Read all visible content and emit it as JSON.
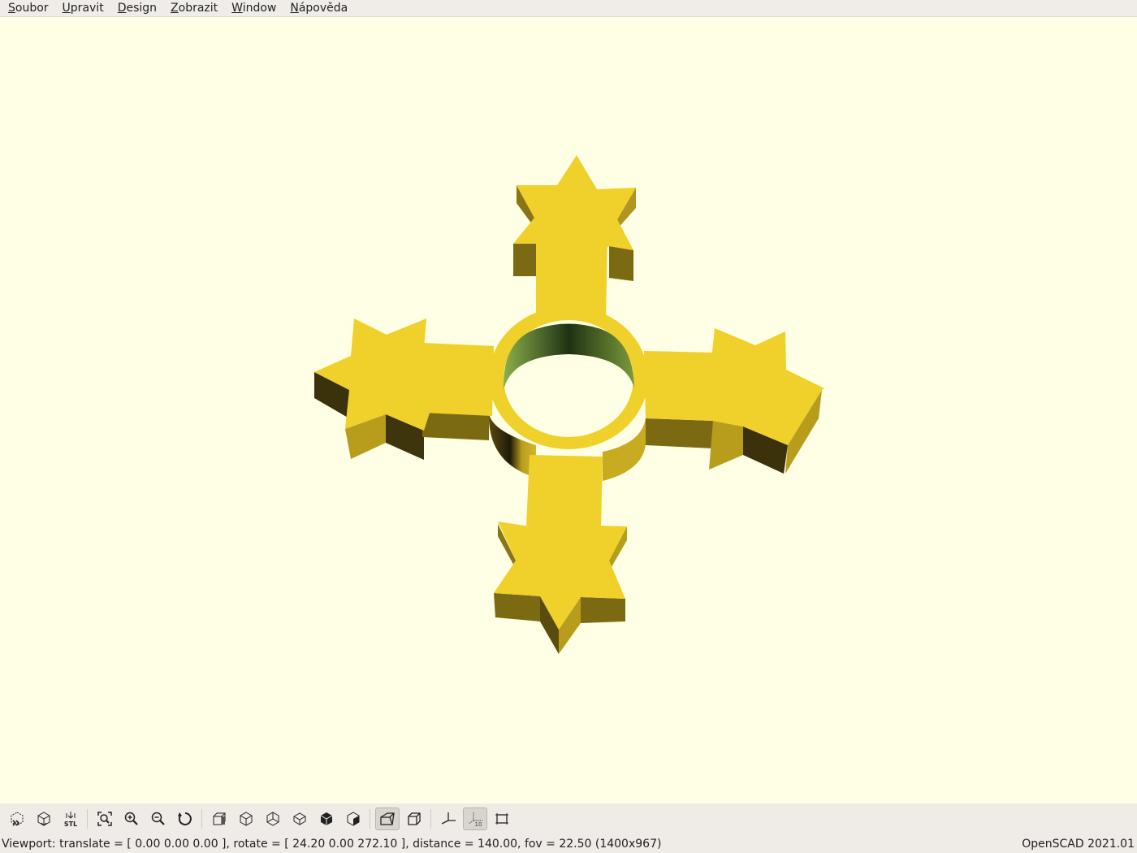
{
  "menubar": {
    "items": [
      {
        "accel": "S",
        "rest": "oubor"
      },
      {
        "accel": "U",
        "rest": "pravit"
      },
      {
        "accel": "D",
        "rest": "esign"
      },
      {
        "accel": "Z",
        "rest": "obrazit"
      },
      {
        "accel": "W",
        "rest": "indow"
      },
      {
        "accel": "N",
        "rest": "ápověda"
      }
    ]
  },
  "viewport": {
    "background": "#ffffe5",
    "model_color": "#f0d02b",
    "model_side_color": "#b89d1d",
    "model_dark_side_color": "#3f350c",
    "hole_inner_color": "#6e9a3c"
  },
  "toolbar": {
    "buttons": [
      {
        "icon": "preview-icon",
        "label": ""
      },
      {
        "icon": "render-icon",
        "label": ""
      },
      {
        "icon": "export-stl-icon",
        "label": "STL"
      },
      {
        "icon": "view-all-icon",
        "label": ""
      },
      {
        "icon": "zoom-in-icon",
        "label": ""
      },
      {
        "icon": "zoom-out-icon",
        "label": ""
      },
      {
        "icon": "reset-view-icon",
        "label": ""
      },
      {
        "icon": "view-right-icon",
        "label": ""
      },
      {
        "icon": "view-top-icon",
        "label": ""
      },
      {
        "icon": "view-bottom-icon",
        "label": ""
      },
      {
        "icon": "view-left-icon",
        "label": ""
      },
      {
        "icon": "view-front-icon",
        "label": ""
      },
      {
        "icon": "view-back-icon",
        "label": ""
      },
      {
        "icon": "perspective-icon",
        "label": ""
      },
      {
        "icon": "orthogonal-icon",
        "label": ""
      },
      {
        "icon": "show-axes-icon",
        "label": ""
      },
      {
        "icon": "show-scale-icon",
        "label": "10"
      },
      {
        "icon": "show-edges-icon",
        "label": ""
      }
    ]
  },
  "statusbar": {
    "viewport_text": "Viewport: translate = [ 0.00 0.00 0.00 ], rotate = [ 24.20 0.00 272.10 ], distance = 140.00, fov = 22.50 (1400x967)",
    "app_version": "OpenSCAD 2021.01"
  }
}
